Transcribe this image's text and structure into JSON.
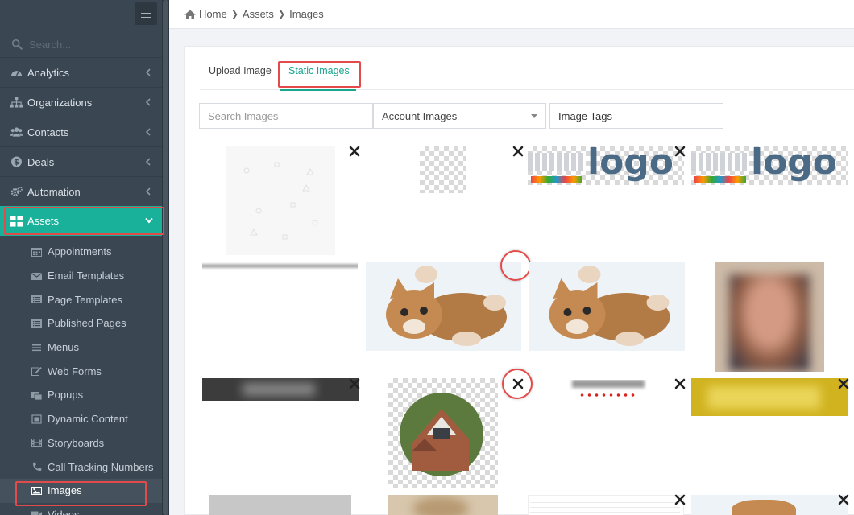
{
  "sidebar": {
    "search_placeholder": "Search...",
    "nav": [
      {
        "label": "Analytics",
        "icon": "dashboard-icon"
      },
      {
        "label": "Organizations",
        "icon": "sitemap-icon"
      },
      {
        "label": "Contacts",
        "icon": "users-icon"
      },
      {
        "label": "Deals",
        "icon": "dollar-icon"
      },
      {
        "label": "Automation",
        "icon": "gears-icon"
      },
      {
        "label": "Assets",
        "icon": "grid-icon",
        "active": true
      }
    ],
    "subnav": [
      {
        "label": "Appointments",
        "icon": "calendar-icon"
      },
      {
        "label": "Email Templates",
        "icon": "envelope-icon"
      },
      {
        "label": "Page Templates",
        "icon": "list-alt-icon"
      },
      {
        "label": "Published Pages",
        "icon": "list-alt-icon"
      },
      {
        "label": "Menus",
        "icon": "bars-icon"
      },
      {
        "label": "Web Forms",
        "icon": "edit-icon"
      },
      {
        "label": "Popups",
        "icon": "window-icon"
      },
      {
        "label": "Dynamic Content",
        "icon": "dynamic-icon"
      },
      {
        "label": "Storyboards",
        "icon": "film-icon"
      },
      {
        "label": "Call Tracking Numbers",
        "icon": "phone-icon"
      },
      {
        "label": "Images",
        "icon": "image-icon",
        "active": true
      },
      {
        "label": "Videos",
        "icon": "video-icon"
      }
    ]
  },
  "breadcrumb": {
    "home": "Home",
    "assets": "Assets",
    "current": "Images"
  },
  "tabs": {
    "upload": "Upload Image",
    "static": "Static Images"
  },
  "filters": {
    "search_placeholder": "Search Images",
    "account_select": "Account Images",
    "tags_label": "Image Tags"
  },
  "logo_text": "logo",
  "colors": {
    "accent": "#19b19a",
    "highlight": "#e34b4b",
    "sidebar": "#3a4652"
  }
}
